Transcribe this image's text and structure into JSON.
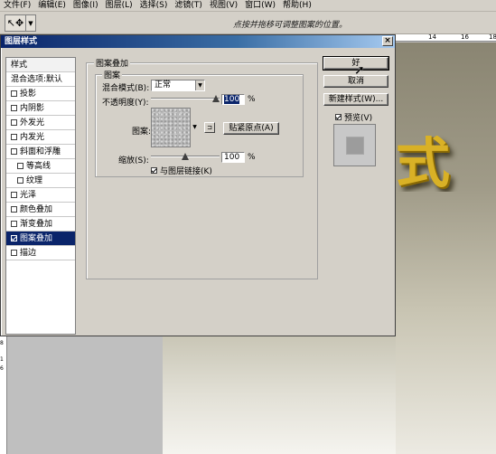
{
  "menubar": {
    "items": [
      "文件(F)",
      "编辑(E)",
      "图像(I)",
      "图层(L)",
      "选择(S)",
      "滤镜(T)",
      "视图(V)",
      "窗口(W)",
      "帮助(H)"
    ]
  },
  "optionsbar": {
    "tool_icon": "move-arrow-icon",
    "hint": "点按并拖移可调整图案的位置。"
  },
  "ruler": {
    "top_ticks": [
      "14",
      "16",
      "18"
    ],
    "left_ticks": [
      "8",
      "1",
      "6"
    ]
  },
  "canvas": {
    "visible_text": "式"
  },
  "dialog": {
    "title": "图层样式",
    "close_label": "×",
    "style_list": {
      "header": "样式",
      "items": [
        {
          "label": "混合选项:默认",
          "checkbox": false,
          "checked": false,
          "indent": false,
          "selected": false
        },
        {
          "label": "投影",
          "checkbox": true,
          "checked": false,
          "indent": false,
          "selected": false
        },
        {
          "label": "内阴影",
          "checkbox": true,
          "checked": false,
          "indent": false,
          "selected": false
        },
        {
          "label": "外发光",
          "checkbox": true,
          "checked": false,
          "indent": false,
          "selected": false
        },
        {
          "label": "内发光",
          "checkbox": true,
          "checked": false,
          "indent": false,
          "selected": false
        },
        {
          "label": "斜面和浮雕",
          "checkbox": true,
          "checked": false,
          "indent": false,
          "selected": false
        },
        {
          "label": "等高线",
          "checkbox": true,
          "checked": false,
          "indent": true,
          "selected": false
        },
        {
          "label": "纹理",
          "checkbox": true,
          "checked": false,
          "indent": true,
          "selected": false
        },
        {
          "label": "光泽",
          "checkbox": true,
          "checked": false,
          "indent": false,
          "selected": false
        },
        {
          "label": "颜色叠加",
          "checkbox": true,
          "checked": false,
          "indent": false,
          "selected": false
        },
        {
          "label": "渐变叠加",
          "checkbox": true,
          "checked": false,
          "indent": false,
          "selected": false
        },
        {
          "label": "图案叠加",
          "checkbox": true,
          "checked": true,
          "indent": false,
          "selected": true
        },
        {
          "label": "描边",
          "checkbox": true,
          "checked": false,
          "indent": false,
          "selected": false
        }
      ]
    },
    "panel": {
      "outer_title": "图案叠加",
      "inner_title": "图案",
      "blend_mode_label": "混合模式(B):",
      "blend_mode_value": "正常",
      "opacity_label": "不透明度(Y):",
      "opacity_value": "100",
      "opacity_unit": "%",
      "opacity_level": 1.0,
      "pattern_label": "图案:",
      "snap_origin_label": "贴紧原点(A)",
      "scale_label": "缩放(S):",
      "scale_value": "100",
      "scale_unit": "%",
      "link_label": "与图层链接(K)",
      "link_checked": true
    },
    "buttons": {
      "ok": "好",
      "cancel": "取消",
      "new_style": "新建样式(W)...",
      "preview_label": "预览(V)",
      "preview_checked": true
    }
  }
}
